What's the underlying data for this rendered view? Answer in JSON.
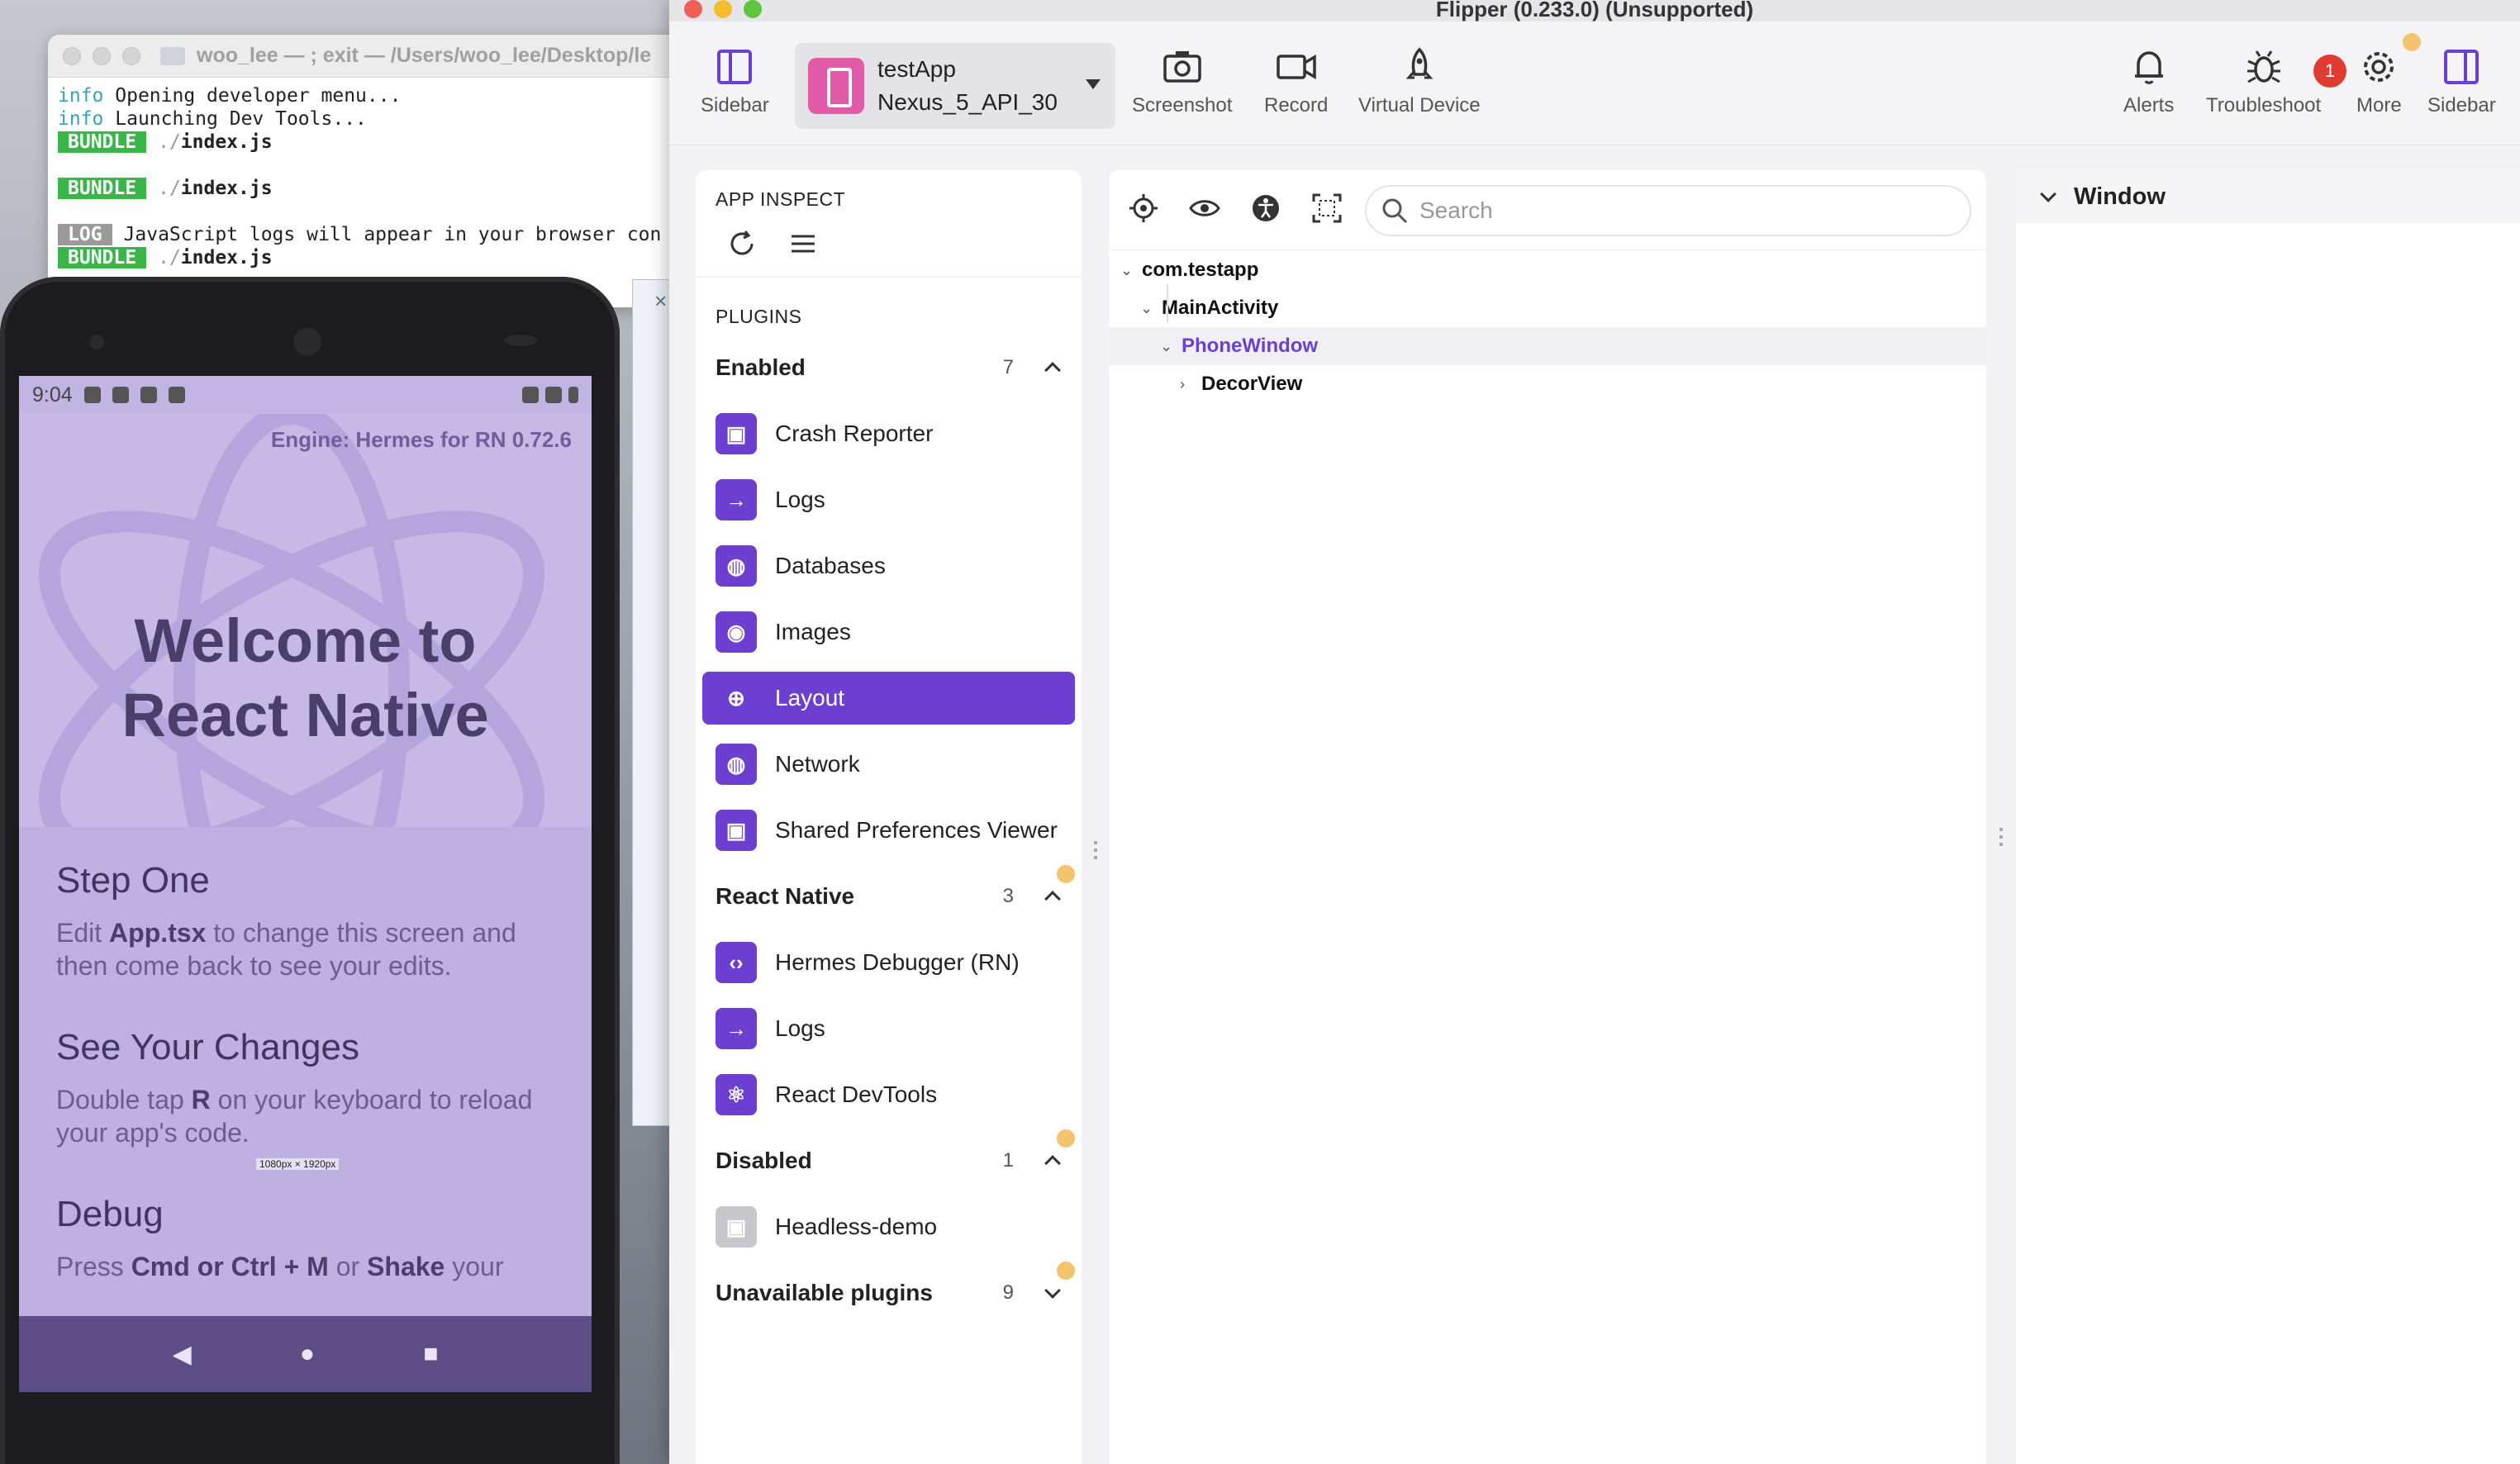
{
  "terminal": {
    "title": "woo_lee — ; exit — /Users/woo_lee/Desktop/le",
    "lines": [
      {
        "tag": "info",
        "text": "Opening developer menu..."
      },
      {
        "tag": "info",
        "text": "Launching Dev Tools..."
      },
      {
        "tag": "BUNDLE",
        "prefix": "./",
        "text": "index.js"
      },
      {
        "tag": "BUNDLE",
        "prefix": "./",
        "text": "index.js"
      },
      {
        "tag": "LOG",
        "text": "JavaScript logs will appear in your browser con"
      },
      {
        "tag": "BUNDLE",
        "prefix": "./",
        "text": "index.js"
      }
    ]
  },
  "phone": {
    "time": "9:04",
    "engine": "Engine: Hermes for RN 0.72.6",
    "welcome_line1": "Welcome to",
    "welcome_line2": "React Native",
    "size_overlay": "1080px × 1920px",
    "sections": [
      {
        "title": "Step One",
        "desc_pre": "Edit ",
        "desc_bold": "App.tsx",
        "desc_post": " to change this screen and then come back to see your edits."
      },
      {
        "title": "See Your Changes",
        "desc_pre": "Double tap ",
        "desc_bold": "R",
        "desc_post": " on your keyboard to reload your app's code."
      },
      {
        "title": "Debug",
        "desc_pre": "Press ",
        "desc_bold": "Cmd or Ctrl + M",
        "desc_mid": " or ",
        "desc_bold2": "Shake",
        "desc_post": " your"
      }
    ]
  },
  "flipper": {
    "window_title": "Flipper (0.233.0) (Unsupported)",
    "toolbar": {
      "sidebar_left": "Sidebar",
      "app_name": "testApp",
      "device_name": "Nexus_5_API_30",
      "screenshot": "Screenshot",
      "record": "Record",
      "virtual_device": "Virtual Device",
      "alerts": "Alerts",
      "troubleshoot": "Troubleshoot",
      "troubleshoot_badge": "1",
      "more": "More",
      "sidebar_right": "Sidebar"
    },
    "left": {
      "app_inspect": "APP INSPECT",
      "plugins_heading": "PLUGINS",
      "enabled": {
        "label": "Enabled",
        "count": "7"
      },
      "enabled_items": [
        "Crash Reporter",
        "Logs",
        "Databases",
        "Images",
        "Layout",
        "Network",
        "Shared Preferences Viewer"
      ],
      "react_native": {
        "label": "React Native",
        "count": "3"
      },
      "rn_items": [
        "Hermes Debugger (RN)",
        "Logs",
        "React DevTools"
      ],
      "disabled": {
        "label": "Disabled",
        "count": "1"
      },
      "disabled_items": [
        "Headless-demo"
      ],
      "unavailable": {
        "label": "Unavailable plugins",
        "count": "9"
      }
    },
    "center": {
      "search_placeholder": "Search",
      "tree": [
        "com.testapp",
        "MainActivity",
        "PhoneWindow",
        "DecorView"
      ]
    },
    "right": {
      "window_label": "Window"
    },
    "colors": {
      "accent": "#6c3fd1",
      "badge": "#e03c31",
      "dot": "#f2c46d"
    }
  }
}
